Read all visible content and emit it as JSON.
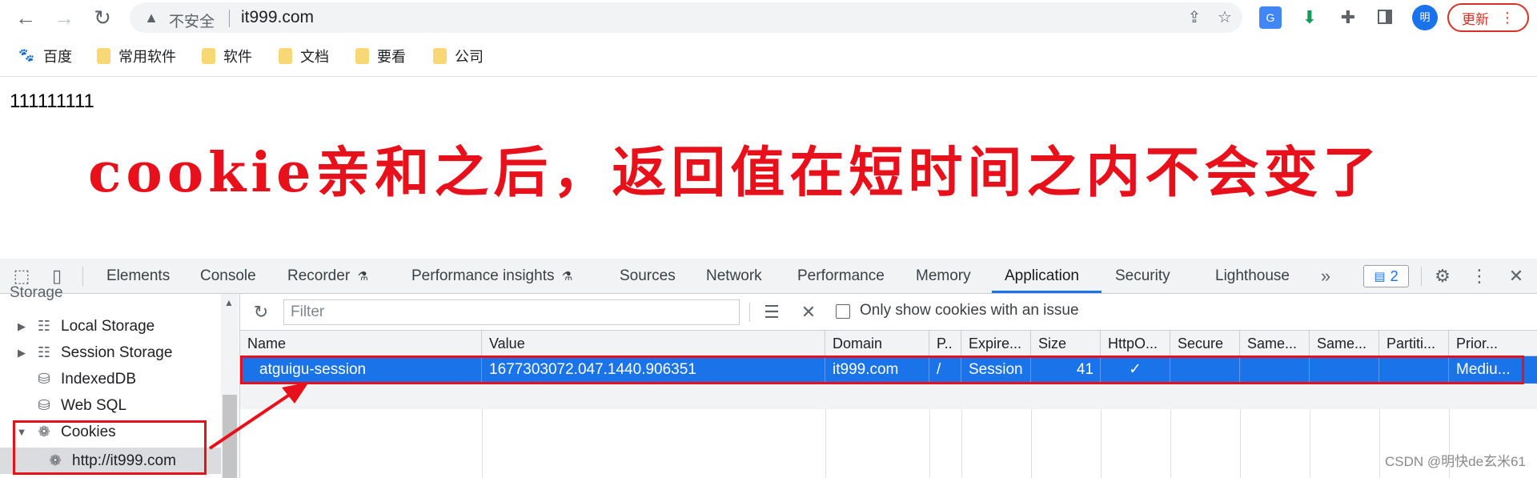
{
  "browser": {
    "address": {
      "security": "不安全",
      "url": "it999.com"
    },
    "update_label": "更新",
    "avatar_label": "明"
  },
  "bookmarks": [
    {
      "label": "百度",
      "icon": "baidu-icon"
    },
    {
      "label": "常用软件",
      "icon": "folder-icon"
    },
    {
      "label": "软件",
      "icon": "folder-icon"
    },
    {
      "label": "文档",
      "icon": "folder-icon"
    },
    {
      "label": "要看",
      "icon": "folder-icon"
    },
    {
      "label": "公司",
      "icon": "folder-icon"
    }
  ],
  "page": {
    "body_text": "111111111",
    "annotation": "cookie亲和之后，返回值在短时间之内不会变了"
  },
  "devtools": {
    "tabs": [
      "Elements",
      "Console",
      "Recorder",
      "Performance insights",
      "Sources",
      "Network",
      "Performance",
      "Memory",
      "Application",
      "Security",
      "Lighthouse"
    ],
    "active_tab": "Application",
    "issues_count": "2",
    "sidebar": {
      "section_header": "Storage",
      "items": [
        "Local Storage",
        "Session Storage",
        "IndexedDB",
        "Web SQL",
        "Cookies"
      ],
      "cookie_origin": "http://it999.com"
    },
    "filter_placeholder": "Filter",
    "only_issues_label": "Only show cookies with an issue",
    "columns": [
      "Name",
      "Value",
      "Domain",
      "P..",
      "Expire...",
      "Size",
      "HttpO...",
      "Secure",
      "Same...",
      "Same...",
      "Partiti...",
      "Prior..."
    ],
    "cookie_row": {
      "name": "atguigu-session",
      "value": "1677303072.047.1440.906351",
      "domain": "it999.com",
      "path": "/",
      "expires": "Session",
      "size": "41",
      "httponly": "✓",
      "secure": "",
      "samesite": "",
      "sameparty": "",
      "partition": "",
      "priority": "Mediu..."
    }
  },
  "watermark": "CSDN @明快de玄米61",
  "colors": {
    "accent": "#1a73e8",
    "annotation_red": "#e8101a"
  }
}
